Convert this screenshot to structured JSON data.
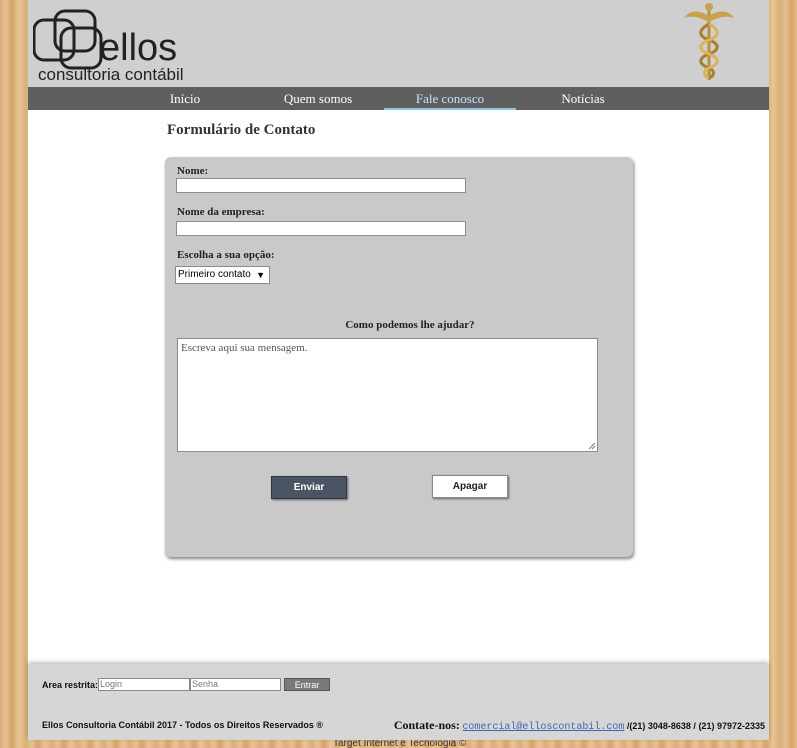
{
  "header": {
    "logo_text": "ellos",
    "logo_subtitle": "consultoria contábil"
  },
  "nav": {
    "items": [
      {
        "label": "Início"
      },
      {
        "label": "Quem somos"
      },
      {
        "label": "Fale conosco",
        "active": true
      },
      {
        "label": "Notícias"
      }
    ]
  },
  "form": {
    "title": "Formulário de Contato",
    "name_label": "Nome:",
    "name_value": "",
    "company_label": "Nome da empresa:",
    "company_value": "",
    "option_label": "Escolha a sua opção:",
    "option_selected": "Primeiro contato",
    "help_label": "Como podemos lhe ajudar?",
    "message_placeholder": "Escreva aqui sua mensagem.",
    "send_label": "Enviar",
    "clear_label": "Apagar"
  },
  "footer": {
    "restricted_label": "Area restrita:",
    "login_placeholder": "Login",
    "password_placeholder": "Senha",
    "enter_label": "Entrar",
    "copyright": "Ellos Consultoria Contábil 2017 - Todos os Direitos Reservados ®",
    "contact_label": "Contate-nos:",
    "email": "comercial@elloscontabil.com",
    "phones": "/(21) 3048-8638 / (21) 97972-2335",
    "credit": "Target Internet e Tecnologia ©"
  },
  "colors": {
    "nav_bg": "#5f5f5f",
    "active_nav": "#bde3ff",
    "panel_bg": "#c9c9c9",
    "send_button": "#4a5462"
  }
}
